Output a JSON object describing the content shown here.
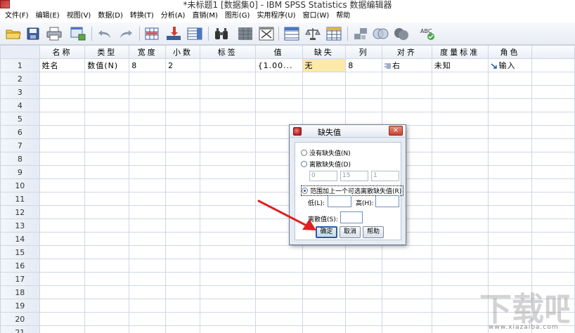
{
  "window": {
    "title": "*未标题1 [数据集0] - IBM SPSS Statistics 数据编辑器"
  },
  "menu": [
    {
      "label": "文件(F)"
    },
    {
      "label": "编辑(E)"
    },
    {
      "label": "视图(V)"
    },
    {
      "label": "数据(D)"
    },
    {
      "label": "转换(T)"
    },
    {
      "label": "分析(A)"
    },
    {
      "label": "直销(M)"
    },
    {
      "label": "图形(G)"
    },
    {
      "label": "实用程序(U)"
    },
    {
      "label": "窗口(W)"
    },
    {
      "label": "帮助"
    }
  ],
  "toolbar": {
    "icons": [
      "open-folder-icon",
      "save-icon",
      "print-icon",
      "dialog-recall-icon",
      "undo-icon",
      "redo-icon",
      "goto-case-icon",
      "goto-variable-icon",
      "variables-icon",
      "find-icon",
      "insert-cases-icon",
      "insert-variable-icon",
      "split-file-icon",
      "weight-cases-icon",
      "select-cases-icon",
      "value-labels-icon",
      "use-sets-icon",
      "show-all-variables-icon",
      "spell-check-icon"
    ]
  },
  "grid": {
    "columns": [
      "名称",
      "类型",
      "宽度",
      "小数",
      "标签",
      "值",
      "缺失",
      "列",
      "对齐",
      "度量标准",
      "角色"
    ],
    "rows": [
      {
        "num": "1",
        "cells": [
          "姓名",
          "数值(N)",
          "8",
          "2",
          "",
          "{1.00...",
          "无",
          "8",
          "右",
          "未知",
          "输入"
        ]
      },
      {
        "num": "2"
      },
      {
        "num": "3"
      },
      {
        "num": "4"
      },
      {
        "num": "5"
      },
      {
        "num": "6"
      },
      {
        "num": "7"
      },
      {
        "num": "8"
      },
      {
        "num": "9"
      },
      {
        "num": "10"
      },
      {
        "num": "11"
      },
      {
        "num": "12"
      },
      {
        "num": "13"
      },
      {
        "num": "14"
      },
      {
        "num": "15"
      },
      {
        "num": "16"
      },
      {
        "num": "17"
      },
      {
        "num": "18"
      },
      {
        "num": "19"
      },
      {
        "num": "20"
      },
      {
        "num": "21"
      }
    ]
  },
  "dialog": {
    "title": "缺失值",
    "close": "×",
    "options": {
      "none": "没有缺失值(N)",
      "discrete": "离散缺失值(D)",
      "range": "范围加上一个可选离散缺失值(R)"
    },
    "selected_option": "range",
    "discrete_values": [
      "0",
      "15",
      "1"
    ],
    "low_label": "低(L):",
    "high_label": "高(H):",
    "low_value": "",
    "high_value": "",
    "discrete_label": "离散值(S):",
    "discrete_value": "",
    "buttons": {
      "ok": "确定",
      "cancel": "取消",
      "help": "帮助"
    }
  },
  "watermark": {
    "text": "下载吧",
    "url": "www.xiazaiba.com"
  }
}
